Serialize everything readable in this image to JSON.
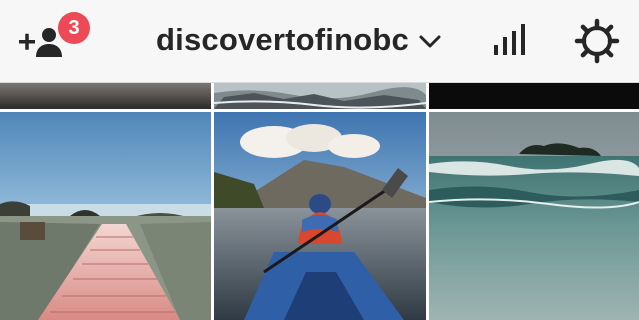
{
  "header": {
    "username": "discovertofinobc",
    "notification_count": "3",
    "icons": {
      "add_user": "add-user-icon",
      "dropdown": "chevron-down-icon",
      "stats": "bar-chart-icon",
      "settings": "gear-icon"
    }
  },
  "colors": {
    "header_bg": "#f7f7f7",
    "badge": "#ed4956",
    "text": "#262626",
    "icon": "#262626"
  },
  "grid": {
    "photos": [
      {
        "subject": "dark shoreline at dusk"
      },
      {
        "subject": "rocky shore with waves"
      },
      {
        "subject": "dark night sky"
      },
      {
        "subject": "wooden boardwalk over frosty grass"
      },
      {
        "subject": "kayaker paddling on a calm inlet"
      },
      {
        "subject": "breaking waves near a wooded island"
      }
    ]
  }
}
